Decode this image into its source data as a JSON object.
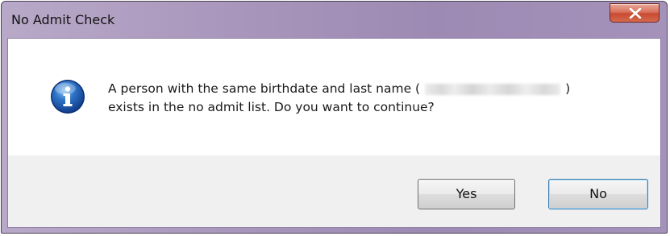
{
  "window": {
    "title": "No Admit Check",
    "close_icon": "close-x-icon"
  },
  "message": {
    "icon": "info-icon",
    "line1_prefix": "A person with the same birthdate and last name (",
    "line1_redacted": "",
    "line1_suffix": ")",
    "line2": "exists in the no admit list.  Do you want  to continue?"
  },
  "buttons": {
    "yes_label": "Yes",
    "no_label": "No"
  },
  "colors": {
    "titlebar": "#a896bc",
    "close_button": "#c84a32",
    "client_background": "#f0f0f0",
    "focus_border": "#3c7fb1"
  }
}
